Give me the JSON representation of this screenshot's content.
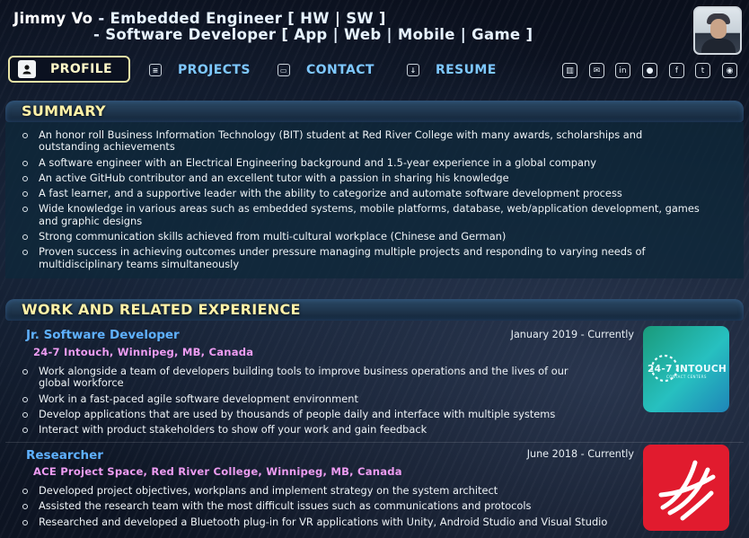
{
  "header": {
    "name": "Jimmy Vo",
    "role1": "Embedded Engineer",
    "tags1": "[ HW | SW ]",
    "role2": "Software Developer",
    "tags2": "[ App | Web | Mobile | Game ]"
  },
  "nav": {
    "items": [
      {
        "label": "PROFILE",
        "icon": "user-icon",
        "active": true
      },
      {
        "label": "PROJECTS",
        "icon": "code-icon"
      },
      {
        "label": "CONTACT",
        "icon": "contact-card-icon"
      },
      {
        "label": "RESUME",
        "icon": "download-icon"
      }
    ],
    "social_icons": [
      "trash-icon",
      "mail-icon",
      "linkedin-icon",
      "github-icon",
      "facebook-icon",
      "twitter-icon",
      "location-pin-icon"
    ]
  },
  "summary": {
    "title": "SUMMARY",
    "items": [
      "An honor roll Business Information Technology (BIT) student at Red River College with many awards, scholarships and outstanding achievements",
      "A software engineer with an Electrical Engineering background and 1.5-year experience in a global company",
      "An active GitHub contributor and an excellent tutor with a passion in sharing his knowledge",
      "A fast learner, and a supportive leader with the ability to categorize and automate software development process",
      "Wide knowledge in various areas such as embedded systems, mobile platforms, database, web/application development, games and graphic designs",
      "Strong communication skills achieved from multi-cultural workplace (Chinese and German)",
      "Proven success in achieving outcomes under pressure managing multiple projects and responding to varying needs of multidisciplinary teams simultaneously"
    ]
  },
  "work": {
    "title": "WORK AND RELATED EXPERIENCE",
    "jobs": [
      {
        "title": "Jr. Software Developer",
        "company": "24-7 Intouch, Winnipeg, MB, Canada",
        "date": "January 2019 - Currently",
        "logo_text": "24-7 INTOUCH",
        "logo_sub": "CONTACT CENTERS",
        "items": [
          "Work alongside a team of developers building tools to improve business operations and the lives of our global workforce",
          "Work in a fast-paced agile software development environment",
          "Develop applications that are used by thousands of people daily and interface with multiple systems",
          "Interact with product stakeholders to show off your work and gain feedback"
        ]
      },
      {
        "title": "Researcher",
        "company": "ACE Project Space, Red River College, Winnipeg, MB, Canada",
        "date": "June 2018 - Currently",
        "items": [
          "Developed project objectives, workplans and implement strategy on the system architect",
          "Assisted the research team with the most difficult issues such as communications and protocols",
          "Researched and developed a Bluetooth plug-in for VR applications with Unity, Android Studio and Visual Studio"
        ]
      }
    ]
  },
  "colors": {
    "accent_yellow": "#fff2a8",
    "link_blue": "#7ec8ff",
    "company_pink": "#ee9cf2",
    "rrc_red": "#e11b2e"
  }
}
